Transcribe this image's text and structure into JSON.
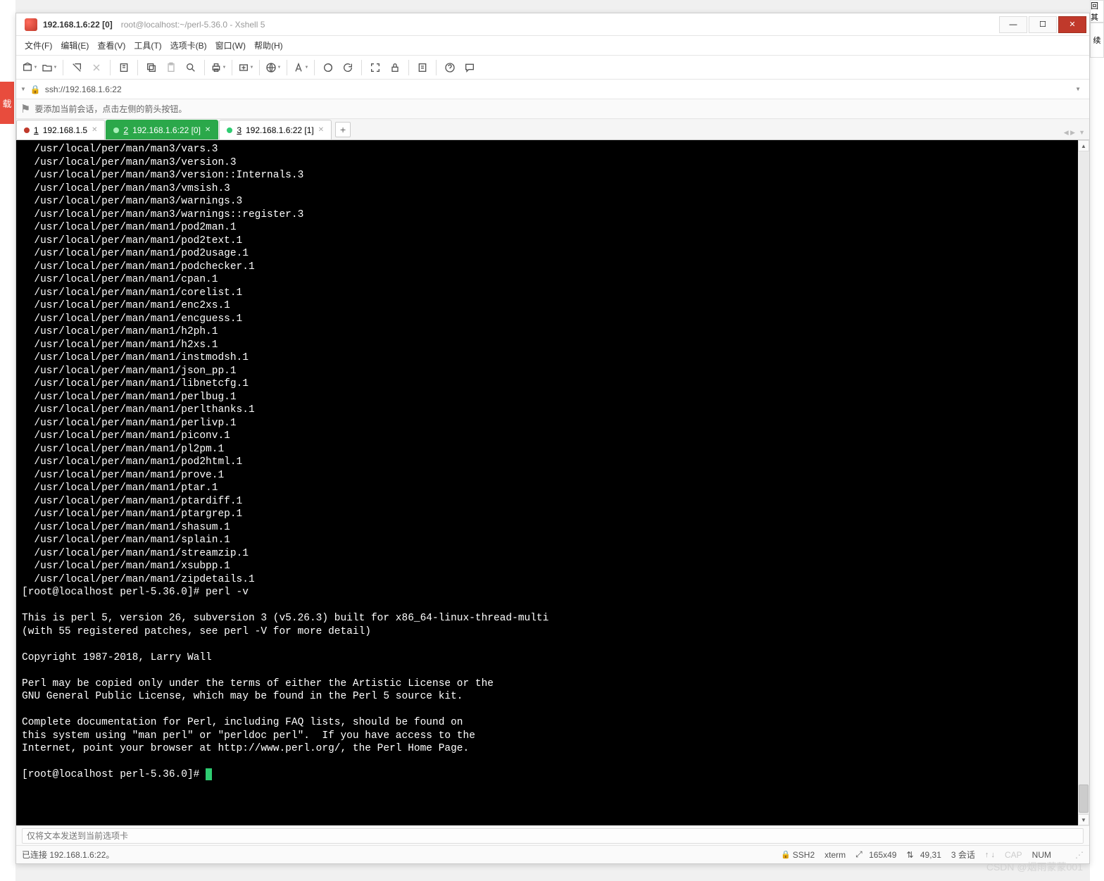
{
  "title_main": "192.168.1.6:22 [0]",
  "title_sub": "root@localhost:~/perl-5.36.0 - Xshell 5",
  "menus": [
    "文件(F)",
    "编辑(E)",
    "查看(V)",
    "工具(T)",
    "选项卡(B)",
    "窗口(W)",
    "帮助(H)"
  ],
  "address": "ssh://192.168.1.6:22",
  "info_text": "要添加当前会话，点击左侧的箭头按钮。",
  "tabs": [
    {
      "num": "1",
      "label": "192.168.1.5",
      "dot": "red",
      "active": false
    },
    {
      "num": "2",
      "label": "192.168.1.6:22 [0]",
      "dot": "green",
      "active": true
    },
    {
      "num": "3",
      "label": "192.168.1.6:22 [1]",
      "dot": "green",
      "active": false
    }
  ],
  "terminal_lines": [
    "  /usr/local/per/man/man3/vars.3",
    "  /usr/local/per/man/man3/version.3",
    "  /usr/local/per/man/man3/version::Internals.3",
    "  /usr/local/per/man/man3/vmsish.3",
    "  /usr/local/per/man/man3/warnings.3",
    "  /usr/local/per/man/man3/warnings::register.3",
    "  /usr/local/per/man/man1/pod2man.1",
    "  /usr/local/per/man/man1/pod2text.1",
    "  /usr/local/per/man/man1/pod2usage.1",
    "  /usr/local/per/man/man1/podchecker.1",
    "  /usr/local/per/man/man1/cpan.1",
    "  /usr/local/per/man/man1/corelist.1",
    "  /usr/local/per/man/man1/enc2xs.1",
    "  /usr/local/per/man/man1/encguess.1",
    "  /usr/local/per/man/man1/h2ph.1",
    "  /usr/local/per/man/man1/h2xs.1",
    "  /usr/local/per/man/man1/instmodsh.1",
    "  /usr/local/per/man/man1/json_pp.1",
    "  /usr/local/per/man/man1/libnetcfg.1",
    "  /usr/local/per/man/man1/perlbug.1",
    "  /usr/local/per/man/man1/perlthanks.1",
    "  /usr/local/per/man/man1/perlivp.1",
    "  /usr/local/per/man/man1/piconv.1",
    "  /usr/local/per/man/man1/pl2pm.1",
    "  /usr/local/per/man/man1/pod2html.1",
    "  /usr/local/per/man/man1/prove.1",
    "  /usr/local/per/man/man1/ptar.1",
    "  /usr/local/per/man/man1/ptardiff.1",
    "  /usr/local/per/man/man1/ptargrep.1",
    "  /usr/local/per/man/man1/shasum.1",
    "  /usr/local/per/man/man1/splain.1",
    "  /usr/local/per/man/man1/streamzip.1",
    "  /usr/local/per/man/man1/xsubpp.1",
    "  /usr/local/per/man/man1/zipdetails.1",
    "[root@localhost perl-5.36.0]# perl -v",
    "",
    "This is perl 5, version 26, subversion 3 (v5.26.3) built for x86_64-linux-thread-multi",
    "(with 55 registered patches, see perl -V for more detail)",
    "",
    "Copyright 1987-2018, Larry Wall",
    "",
    "Perl may be copied only under the terms of either the Artistic License or the",
    "GNU General Public License, which may be found in the Perl 5 source kit.",
    "",
    "Complete documentation for Perl, including FAQ lists, should be found on",
    "this system using \"man perl\" or \"perldoc perl\".  If you have access to the",
    "Internet, point your browser at http://www.perl.org/, the Perl Home Page.",
    ""
  ],
  "prompt_final": "[root@localhost perl-5.36.0]# ",
  "input_hint": "仅将文本发送到当前选项卡",
  "status": {
    "left": "已连接 192.168.1.6:22。",
    "ssh": "SSH2",
    "term": "xterm",
    "size": "165x49",
    "cursor_symbol": "⇅",
    "cursor": "49,31",
    "sess": "3 会话",
    "cap": "CAP",
    "num": "NUM"
  },
  "watermark": "CSDN @烟雨蒙蒙001",
  "bg_left": "载",
  "bg_right_top": "回 其",
  "bg_right_mid": "续"
}
